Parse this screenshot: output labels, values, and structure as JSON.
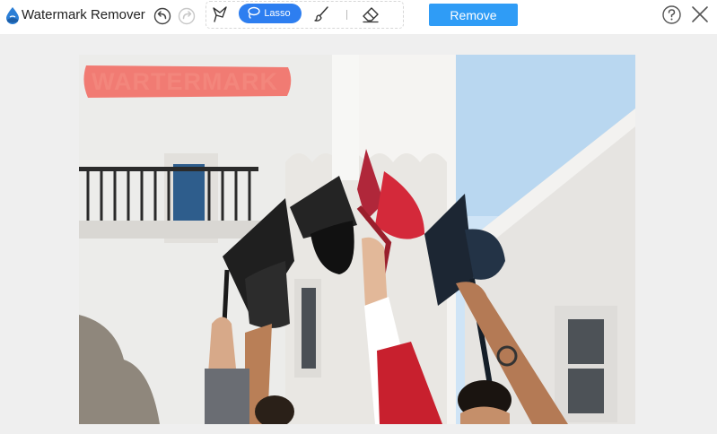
{
  "app": {
    "title": "Watermark Remover",
    "logo_icon": "water-drop-icon",
    "accent_color": "#2d7ef0"
  },
  "toolbar": {
    "undo_icon": "undo-icon",
    "redo_icon": "redo-icon",
    "tools": [
      {
        "name": "polygon",
        "icon": "polygonal-lasso-icon",
        "active": false
      },
      {
        "name": "lasso",
        "label": "Lasso",
        "icon": "lasso-icon",
        "active": true
      },
      {
        "name": "brush",
        "icon": "brush-icon",
        "active": false
      },
      {
        "name": "eraser",
        "icon": "eraser-icon",
        "active": false
      }
    ],
    "remove_label": "Remove",
    "remove_color": "#2f9cf6",
    "help_icon": "help-icon",
    "close_icon": "close-icon"
  },
  "canvas": {
    "image_subject": "graduation caps thrown into the air",
    "watermark_text": "WARTERMARK",
    "selection_color": "#f26f66"
  }
}
